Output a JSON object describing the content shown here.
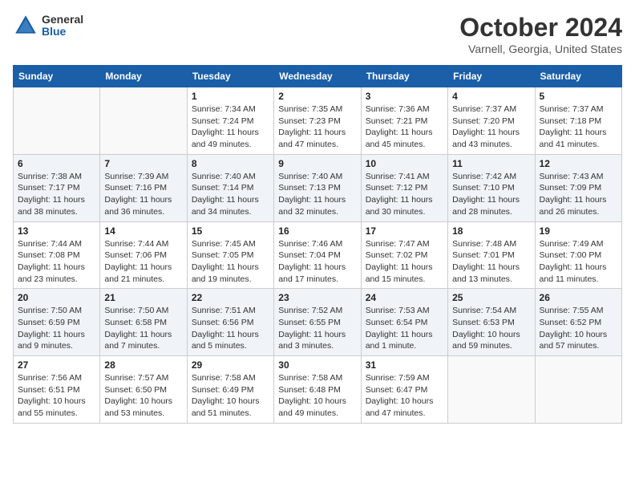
{
  "header": {
    "logo_general": "General",
    "logo_blue": "Blue",
    "month_title": "October 2024",
    "location": "Varnell, Georgia, United States"
  },
  "days_of_week": [
    "Sunday",
    "Monday",
    "Tuesday",
    "Wednesday",
    "Thursday",
    "Friday",
    "Saturday"
  ],
  "weeks": [
    [
      {
        "day": "",
        "sunrise": "",
        "sunset": "",
        "daylight": ""
      },
      {
        "day": "",
        "sunrise": "",
        "sunset": "",
        "daylight": ""
      },
      {
        "day": "1",
        "sunrise": "Sunrise: 7:34 AM",
        "sunset": "Sunset: 7:24 PM",
        "daylight": "Daylight: 11 hours and 49 minutes."
      },
      {
        "day": "2",
        "sunrise": "Sunrise: 7:35 AM",
        "sunset": "Sunset: 7:23 PM",
        "daylight": "Daylight: 11 hours and 47 minutes."
      },
      {
        "day": "3",
        "sunrise": "Sunrise: 7:36 AM",
        "sunset": "Sunset: 7:21 PM",
        "daylight": "Daylight: 11 hours and 45 minutes."
      },
      {
        "day": "4",
        "sunrise": "Sunrise: 7:37 AM",
        "sunset": "Sunset: 7:20 PM",
        "daylight": "Daylight: 11 hours and 43 minutes."
      },
      {
        "day": "5",
        "sunrise": "Sunrise: 7:37 AM",
        "sunset": "Sunset: 7:18 PM",
        "daylight": "Daylight: 11 hours and 41 minutes."
      }
    ],
    [
      {
        "day": "6",
        "sunrise": "Sunrise: 7:38 AM",
        "sunset": "Sunset: 7:17 PM",
        "daylight": "Daylight: 11 hours and 38 minutes."
      },
      {
        "day": "7",
        "sunrise": "Sunrise: 7:39 AM",
        "sunset": "Sunset: 7:16 PM",
        "daylight": "Daylight: 11 hours and 36 minutes."
      },
      {
        "day": "8",
        "sunrise": "Sunrise: 7:40 AM",
        "sunset": "Sunset: 7:14 PM",
        "daylight": "Daylight: 11 hours and 34 minutes."
      },
      {
        "day": "9",
        "sunrise": "Sunrise: 7:40 AM",
        "sunset": "Sunset: 7:13 PM",
        "daylight": "Daylight: 11 hours and 32 minutes."
      },
      {
        "day": "10",
        "sunrise": "Sunrise: 7:41 AM",
        "sunset": "Sunset: 7:12 PM",
        "daylight": "Daylight: 11 hours and 30 minutes."
      },
      {
        "day": "11",
        "sunrise": "Sunrise: 7:42 AM",
        "sunset": "Sunset: 7:10 PM",
        "daylight": "Daylight: 11 hours and 28 minutes."
      },
      {
        "day": "12",
        "sunrise": "Sunrise: 7:43 AM",
        "sunset": "Sunset: 7:09 PM",
        "daylight": "Daylight: 11 hours and 26 minutes."
      }
    ],
    [
      {
        "day": "13",
        "sunrise": "Sunrise: 7:44 AM",
        "sunset": "Sunset: 7:08 PM",
        "daylight": "Daylight: 11 hours and 23 minutes."
      },
      {
        "day": "14",
        "sunrise": "Sunrise: 7:44 AM",
        "sunset": "Sunset: 7:06 PM",
        "daylight": "Daylight: 11 hours and 21 minutes."
      },
      {
        "day": "15",
        "sunrise": "Sunrise: 7:45 AM",
        "sunset": "Sunset: 7:05 PM",
        "daylight": "Daylight: 11 hours and 19 minutes."
      },
      {
        "day": "16",
        "sunrise": "Sunrise: 7:46 AM",
        "sunset": "Sunset: 7:04 PM",
        "daylight": "Daylight: 11 hours and 17 minutes."
      },
      {
        "day": "17",
        "sunrise": "Sunrise: 7:47 AM",
        "sunset": "Sunset: 7:02 PM",
        "daylight": "Daylight: 11 hours and 15 minutes."
      },
      {
        "day": "18",
        "sunrise": "Sunrise: 7:48 AM",
        "sunset": "Sunset: 7:01 PM",
        "daylight": "Daylight: 11 hours and 13 minutes."
      },
      {
        "day": "19",
        "sunrise": "Sunrise: 7:49 AM",
        "sunset": "Sunset: 7:00 PM",
        "daylight": "Daylight: 11 hours and 11 minutes."
      }
    ],
    [
      {
        "day": "20",
        "sunrise": "Sunrise: 7:50 AM",
        "sunset": "Sunset: 6:59 PM",
        "daylight": "Daylight: 11 hours and 9 minutes."
      },
      {
        "day": "21",
        "sunrise": "Sunrise: 7:50 AM",
        "sunset": "Sunset: 6:58 PM",
        "daylight": "Daylight: 11 hours and 7 minutes."
      },
      {
        "day": "22",
        "sunrise": "Sunrise: 7:51 AM",
        "sunset": "Sunset: 6:56 PM",
        "daylight": "Daylight: 11 hours and 5 minutes."
      },
      {
        "day": "23",
        "sunrise": "Sunrise: 7:52 AM",
        "sunset": "Sunset: 6:55 PM",
        "daylight": "Daylight: 11 hours and 3 minutes."
      },
      {
        "day": "24",
        "sunrise": "Sunrise: 7:53 AM",
        "sunset": "Sunset: 6:54 PM",
        "daylight": "Daylight: 11 hours and 1 minute."
      },
      {
        "day": "25",
        "sunrise": "Sunrise: 7:54 AM",
        "sunset": "Sunset: 6:53 PM",
        "daylight": "Daylight: 10 hours and 59 minutes."
      },
      {
        "day": "26",
        "sunrise": "Sunrise: 7:55 AM",
        "sunset": "Sunset: 6:52 PM",
        "daylight": "Daylight: 10 hours and 57 minutes."
      }
    ],
    [
      {
        "day": "27",
        "sunrise": "Sunrise: 7:56 AM",
        "sunset": "Sunset: 6:51 PM",
        "daylight": "Daylight: 10 hours and 55 minutes."
      },
      {
        "day": "28",
        "sunrise": "Sunrise: 7:57 AM",
        "sunset": "Sunset: 6:50 PM",
        "daylight": "Daylight: 10 hours and 53 minutes."
      },
      {
        "day": "29",
        "sunrise": "Sunrise: 7:58 AM",
        "sunset": "Sunset: 6:49 PM",
        "daylight": "Daylight: 10 hours and 51 minutes."
      },
      {
        "day": "30",
        "sunrise": "Sunrise: 7:58 AM",
        "sunset": "Sunset: 6:48 PM",
        "daylight": "Daylight: 10 hours and 49 minutes."
      },
      {
        "day": "31",
        "sunrise": "Sunrise: 7:59 AM",
        "sunset": "Sunset: 6:47 PM",
        "daylight": "Daylight: 10 hours and 47 minutes."
      },
      {
        "day": "",
        "sunrise": "",
        "sunset": "",
        "daylight": ""
      },
      {
        "day": "",
        "sunrise": "",
        "sunset": "",
        "daylight": ""
      }
    ]
  ]
}
